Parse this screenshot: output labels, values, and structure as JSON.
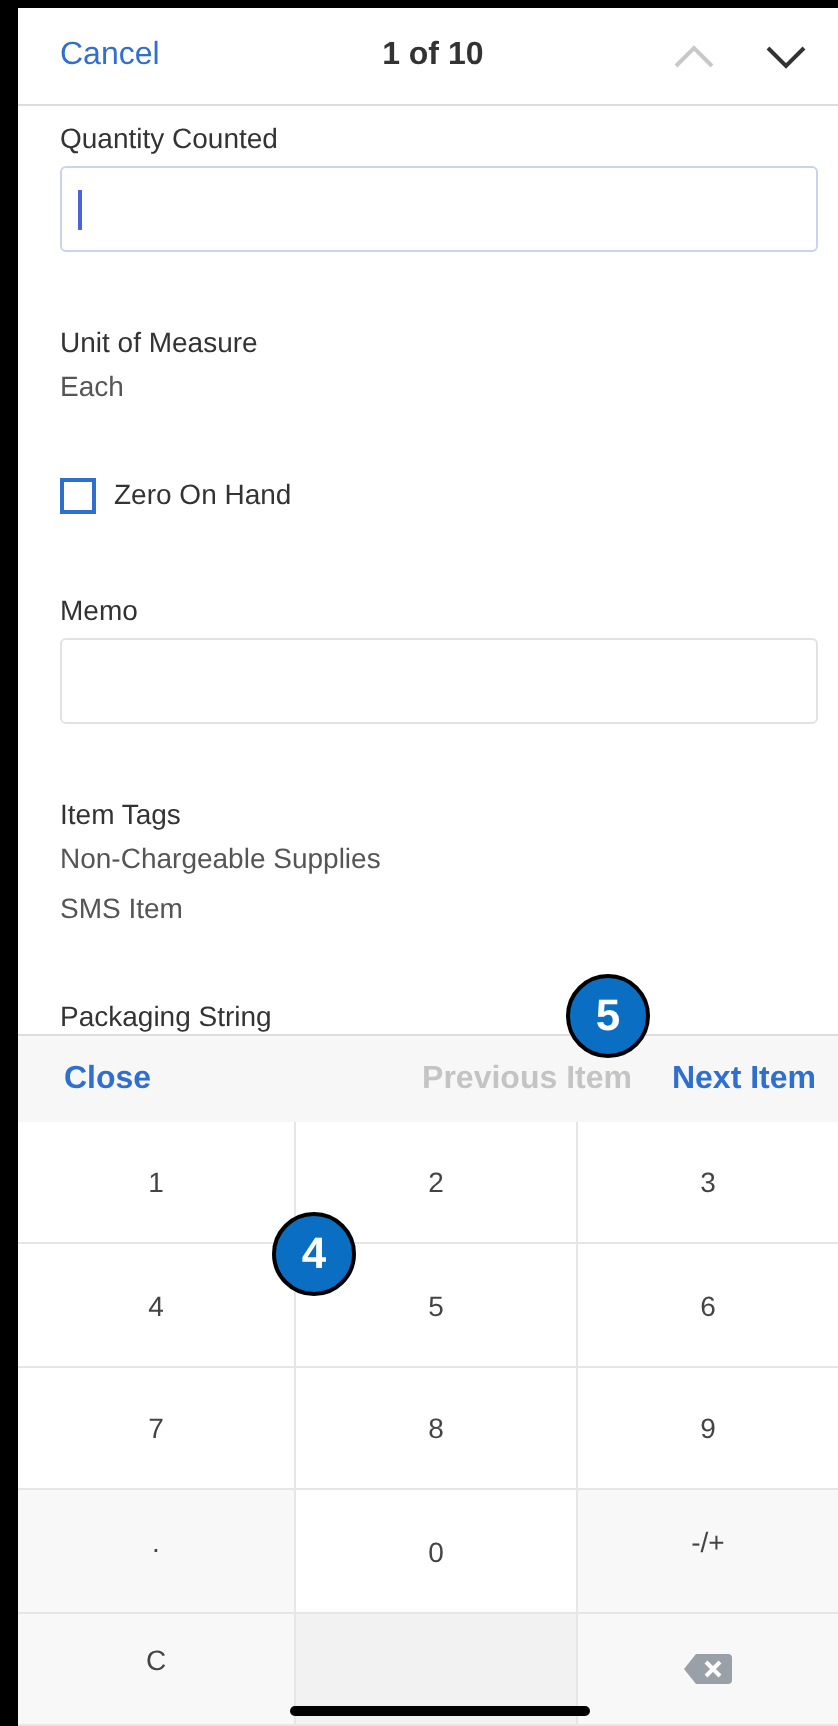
{
  "header": {
    "cancel": "Cancel",
    "position": "1 of 10",
    "prev": {
      "disabled": true
    },
    "next": {
      "disabled": false
    }
  },
  "form": [
    {
      "kind": "input",
      "label": "Quantity Counted",
      "focused": true
    },
    {
      "kind": "text",
      "label": "Unit of Measure",
      "values": [
        "Each"
      ]
    },
    {
      "kind": "checkbox",
      "label": "Zero On Hand",
      "checked": false
    },
    {
      "kind": "input",
      "label": "Memo",
      "focused": false
    },
    {
      "kind": "text",
      "label": "Item Tags",
      "values": [
        "Non-Chargeable Supplies",
        "SMS Item"
      ]
    },
    {
      "kind": "text",
      "label": "Packaging String"
    }
  ],
  "toolbar": {
    "close": "Close",
    "previous": {
      "label": "Previous Item",
      "disabled": true
    },
    "next": {
      "label": "Next Item",
      "disabled": false
    }
  },
  "keypad": [
    {
      "kind": "key",
      "label": "1"
    },
    {
      "kind": "key",
      "label": "2"
    },
    {
      "kind": "key",
      "label": "3"
    },
    {
      "kind": "key",
      "label": "4"
    },
    {
      "kind": "key",
      "label": "5"
    },
    {
      "kind": "key",
      "label": "6"
    },
    {
      "kind": "key",
      "label": "7"
    },
    {
      "kind": "key",
      "label": "8"
    },
    {
      "kind": "key",
      "label": "9"
    },
    {
      "kind": "function",
      "label": "."
    },
    {
      "kind": "key",
      "label": "0"
    },
    {
      "kind": "function",
      "label": "-/+"
    },
    {
      "kind": "function",
      "label": "C"
    },
    {
      "kind": "blank"
    },
    {
      "kind": "backspace"
    }
  ],
  "callouts": [
    "5",
    "4"
  ]
}
